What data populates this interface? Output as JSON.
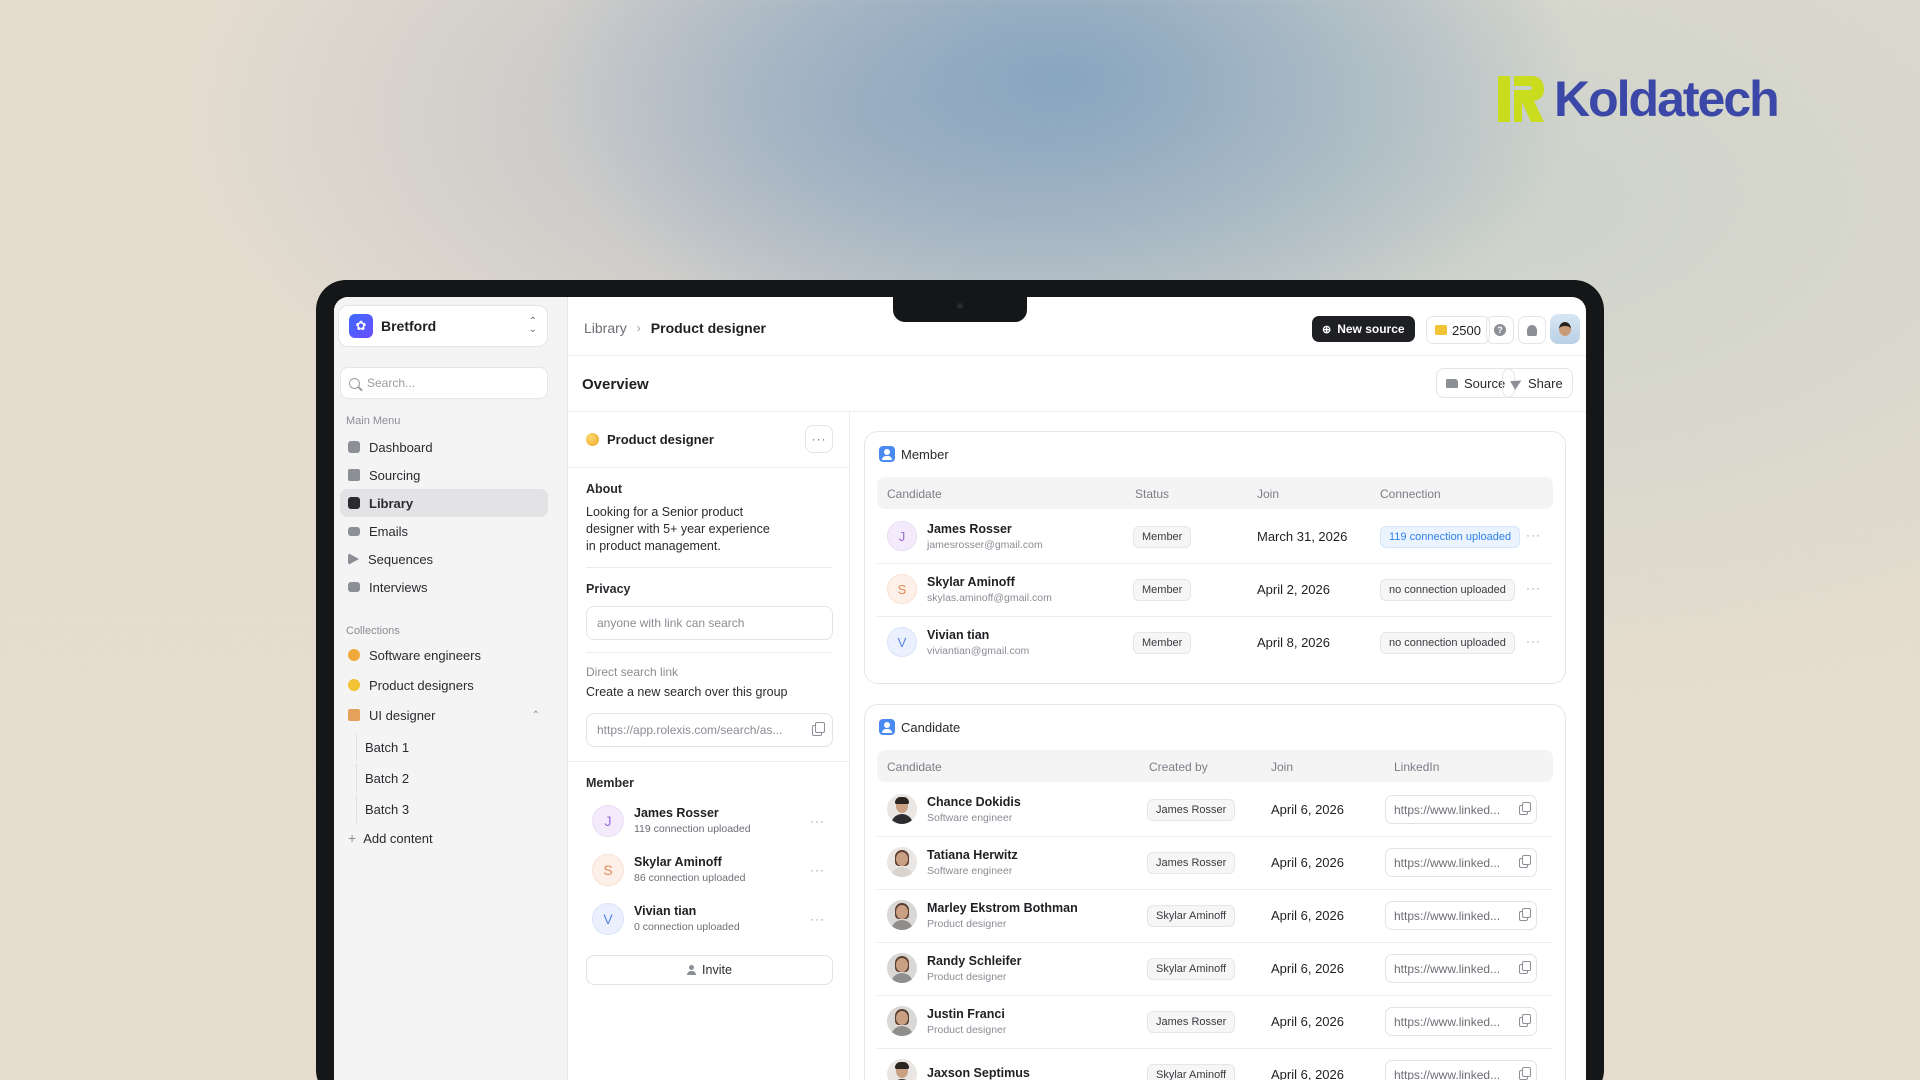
{
  "brand": {
    "logo_text": "Koldatech",
    "mark_color": "#c9dc1e",
    "text_color": "#3b48a8"
  },
  "workspace": {
    "name": "Bretford"
  },
  "search": {
    "placeholder": "Search..."
  },
  "sidebar": {
    "main_menu_label": "Main Menu",
    "main_items": [
      {
        "label": "Dashboard",
        "icon": "home-icon"
      },
      {
        "label": "Sourcing",
        "icon": "document-icon"
      },
      {
        "label": "Library",
        "icon": "library-icon",
        "active": true
      },
      {
        "label": "Emails",
        "icon": "mail-icon"
      },
      {
        "label": "Sequences",
        "icon": "send-icon"
      },
      {
        "label": "Interviews",
        "icon": "chat-icon"
      }
    ],
    "collections_label": "Collections",
    "collections": [
      {
        "label": "Software engineers",
        "icon": "gear-emoji-icon",
        "color": "#f2a93b"
      },
      {
        "label": "Product designers",
        "icon": "palette-emoji-icon",
        "color": "#f2c335"
      },
      {
        "label": "UI designer",
        "icon": "folder-emoji-icon",
        "color": "#e5a05a",
        "expanded": true
      }
    ],
    "sub_items": [
      "Batch 1",
      "Batch 2",
      "Batch 3"
    ],
    "add_content": "Add content"
  },
  "topbar": {
    "breadcrumb": [
      "Library",
      "Product designer"
    ],
    "new_source": "New source",
    "credits": "2500"
  },
  "overview": {
    "title": "Overview",
    "source_btn": "Source",
    "share_btn": "Share"
  },
  "group": {
    "title": "Product designer",
    "about_label": "About",
    "about_text": "Looking for a Senior product designer with 5+ year experience in product management.",
    "privacy_label": "Privacy",
    "privacy_value": "anyone with link can search",
    "direct_link_label": "Direct search link",
    "direct_link_desc": "Create a new search over this group",
    "direct_link_value": "https://app.rolexis.com/search/as...",
    "member_label": "Member",
    "members": [
      {
        "initial": "J",
        "name": "James Rosser",
        "sub": "119 connection uploaded"
      },
      {
        "initial": "S",
        "name": "Skylar Aminoff",
        "sub": "86 connection uploaded"
      },
      {
        "initial": "V",
        "name": "Vivian tian",
        "sub": "0 connection uploaded"
      }
    ],
    "invite": "Invite"
  },
  "member_card": {
    "title": "Member",
    "columns": [
      "Candidate",
      "Status",
      "Join",
      "Connection"
    ],
    "rows": [
      {
        "initial": "J",
        "name": "James Rosser",
        "email": "jamesrosser@gmail.com",
        "status": "Member",
        "join": "March 31, 2026",
        "connection": "119 connection uploaded",
        "highlight": true
      },
      {
        "initial": "S",
        "name": "Skylar Aminoff",
        "email": "skylas.aminoff@gmail.com",
        "status": "Member",
        "join": "April 2, 2026",
        "connection": "no connection uploaded",
        "highlight": false
      },
      {
        "initial": "V",
        "name": "Vivian tian",
        "email": "viviantian@gmail.com",
        "status": "Member",
        "join": "April 8, 2026",
        "connection": "no connection uploaded",
        "highlight": false
      }
    ]
  },
  "candidate_card": {
    "title": "Candidate",
    "columns": [
      "Candidate",
      "Created by",
      "Join",
      "LinkedIn"
    ],
    "rows": [
      {
        "name": "Chance Dokidis",
        "role": "Software engineer",
        "created_by": "James Rosser",
        "join": "April 6, 2026",
        "linkedin": "https://www.linked..."
      },
      {
        "name": "Tatiana Herwitz",
        "role": "Software engineer",
        "created_by": "James Rosser",
        "join": "April 6, 2026",
        "linkedin": "https://www.linked..."
      },
      {
        "name": "Marley Ekstrom Bothman",
        "role": "Product designer",
        "created_by": "Skylar Aminoff",
        "join": "April 6, 2026",
        "linkedin": "https://www.linked..."
      },
      {
        "name": "Randy Schleifer",
        "role": "Product designer",
        "created_by": "Skylar Aminoff",
        "join": "April 6, 2026",
        "linkedin": "https://www.linked..."
      },
      {
        "name": "Justin Franci",
        "role": "Product designer",
        "created_by": "James Rosser",
        "join": "April 6, 2026",
        "linkedin": "https://www.linked..."
      },
      {
        "name": "Jaxson Septimus",
        "role": "",
        "created_by": "Skylar Aminoff",
        "join": "April 6, 2026",
        "linkedin": "https://www.linked..."
      }
    ]
  }
}
